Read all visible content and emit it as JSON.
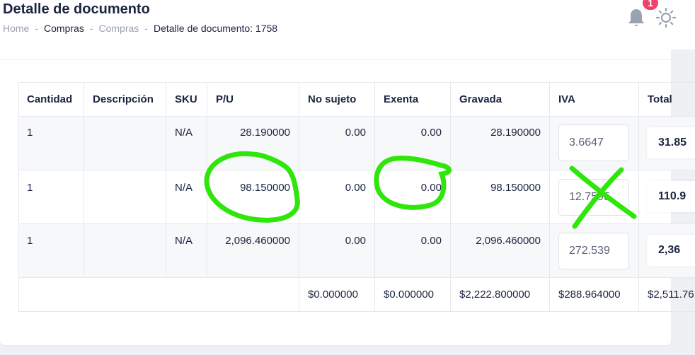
{
  "page": {
    "title": "Detalle de documento",
    "breadcrumb": [
      "Home",
      "Compras",
      "Compras",
      "Detalle de documento: 1758"
    ],
    "notification_count": "1"
  },
  "table": {
    "headers": [
      "Cantidad",
      "Descripción",
      "SKU",
      "P/U",
      "No sujeto",
      "Exenta",
      "Gravada",
      "IVA",
      "Total"
    ],
    "rows": [
      {
        "cantidad": "1",
        "descripcion": "",
        "sku": "N/A",
        "pu": "28.190000",
        "no_sujeto": "0.00",
        "exenta": "0.00",
        "gravada": "28.190000",
        "iva": "3.6647",
        "total": "31.85"
      },
      {
        "cantidad": "1",
        "descripcion": "",
        "sku": "N/A",
        "pu": "98.150000",
        "no_sujeto": "0.00",
        "exenta": "0.00",
        "gravada": "98.150000",
        "iva": "12.7595",
        "total": "110.9"
      },
      {
        "cantidad": "1",
        "descripcion": "",
        "sku": "N/A",
        "pu": "2,096.460000",
        "no_sujeto": "0.00",
        "exenta": "0.00",
        "gravada": "2,096.460000",
        "iva": "272.539",
        "total": "2,36"
      }
    ],
    "totals": {
      "no_sujeto": "$0.000000",
      "exenta": "$0.000000",
      "gravada": "$2,222.800000",
      "iva": "$288.964000",
      "total": "$2,511.76"
    }
  },
  "colors": {
    "scribble": "#2ee60a",
    "badge": "#f0416c",
    "text": "#1b2440"
  },
  "icons": [
    "bell-icon",
    "sun-icon"
  ]
}
